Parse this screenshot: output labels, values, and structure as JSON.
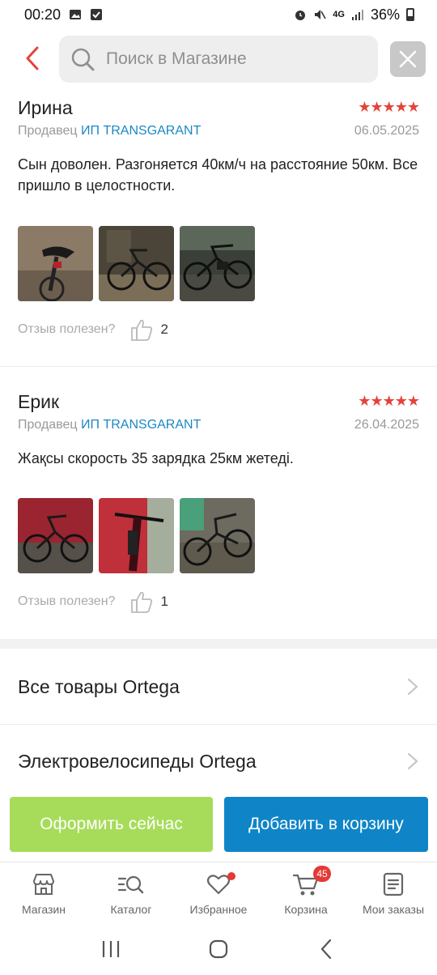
{
  "status_bar": {
    "time": "00:20",
    "network": "4G",
    "battery": "36%"
  },
  "search": {
    "placeholder": "Поиск в Магазине"
  },
  "reviews": [
    {
      "author": "Ирина",
      "rating": 5,
      "stars": "★★★★★",
      "seller_label": "Продавец",
      "seller_name": "ИП TRANSGARANT",
      "date": "06.05.2025",
      "text": "Сын доволен. Разгоняется 40км/ч на расстояние 50км. Все пришло в целостности.",
      "helpful_label": "Отзыв полезен?",
      "helpful_count": "2"
    },
    {
      "author": "Ерик",
      "rating": 5,
      "stars": "★★★★★",
      "seller_label": "Продавец",
      "seller_name": "ИП TRANSGARANT",
      "date": "26.04.2025",
      "text": "Жақсы скорость 35 зарядка 25км жетеді.",
      "helpful_label": "Отзыв полезен?",
      "helpful_count": "1"
    }
  ],
  "links": {
    "all_products": "Все товары Ortega",
    "ebikes": "Электровелосипеды Ortega"
  },
  "actions": {
    "buy_now": "Оформить сейчас",
    "add_to_cart": "Добавить в корзину"
  },
  "bottom_nav": {
    "items": [
      {
        "label": "Магазин",
        "icon": "store-icon"
      },
      {
        "label": "Каталог",
        "icon": "catalog-search-icon"
      },
      {
        "label": "Избранное",
        "icon": "heart-icon"
      },
      {
        "label": "Корзина",
        "icon": "cart-icon"
      },
      {
        "label": "Мои заказы",
        "icon": "orders-icon"
      }
    ],
    "cart_badge": "45"
  },
  "colors": {
    "accent_red": "#e5433a",
    "seller_link": "#1b87c5",
    "buy_green": "#a6dc5a",
    "cart_blue": "#0f85c8"
  }
}
